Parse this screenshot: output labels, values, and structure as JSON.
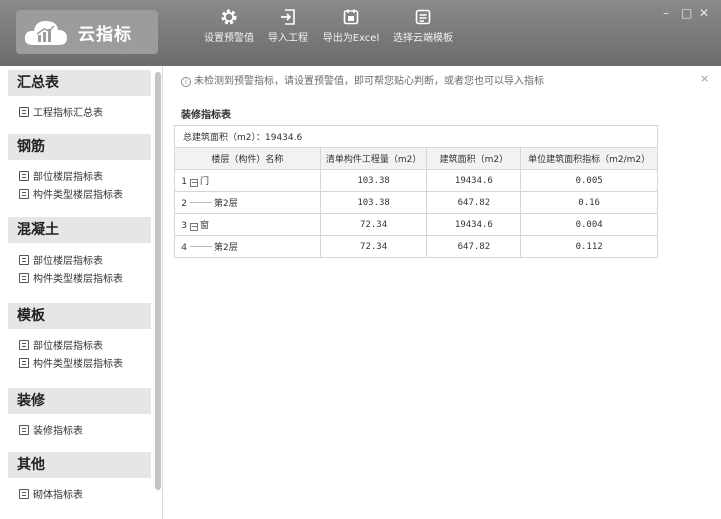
{
  "app": {
    "title": "云指标"
  },
  "toolbar": [
    {
      "label": "设置预警值",
      "icon": "gear-icon"
    },
    {
      "label": "导入工程",
      "icon": "import-icon"
    },
    {
      "label": "导出为Excel",
      "icon": "export-excel-icon"
    },
    {
      "label": "选择云端模板",
      "icon": "template-icon"
    }
  ],
  "window_controls": {
    "minimize": "–",
    "maximize": "□",
    "close": "✕"
  },
  "sidebar": {
    "sections": [
      {
        "title": "汇总表",
        "items": [
          "工程指标汇总表"
        ]
      },
      {
        "title": "钢筋",
        "items": [
          "部位楼层指标表",
          "构件类型楼层指标表"
        ]
      },
      {
        "title": "混凝土",
        "items": [
          "部位楼层指标表",
          "构件类型楼层指标表"
        ]
      },
      {
        "title": "模板",
        "items": [
          "部位楼层指标表",
          "构件类型楼层指标表"
        ]
      },
      {
        "title": "装修",
        "items": [
          "装修指标表"
        ]
      },
      {
        "title": "其他",
        "items": [
          "砌体指标表"
        ]
      }
    ]
  },
  "notice": {
    "icon": "info-icon",
    "text": "未检测到预警指标，请设置预警值，即可帮您贴心判断，或者您也可以导入指标",
    "close": "×"
  },
  "table": {
    "title": "装修指标表",
    "total_label": "总建筑面积（m2）：19434.6",
    "headers": [
      "楼层（构件）名称",
      "清单构件工程量（m2）",
      "建筑面积（m2）",
      "单位建筑面积指标（m2/m2）"
    ],
    "rows": [
      {
        "no": "1",
        "toggle": "−",
        "name": "门",
        "qty": "103.38",
        "area": "19434.6",
        "index": "0.005"
      },
      {
        "no": "2",
        "name": "第2层",
        "qty": "103.38",
        "area": "647.82",
        "index": "0.16"
      },
      {
        "no": "3",
        "toggle": "−",
        "name": "窗",
        "qty": "72.34",
        "area": "19434.6",
        "index": "0.004"
      },
      {
        "no": "4",
        "name": "第2层",
        "qty": "72.34",
        "area": "647.82",
        "index": "0.112"
      }
    ]
  }
}
